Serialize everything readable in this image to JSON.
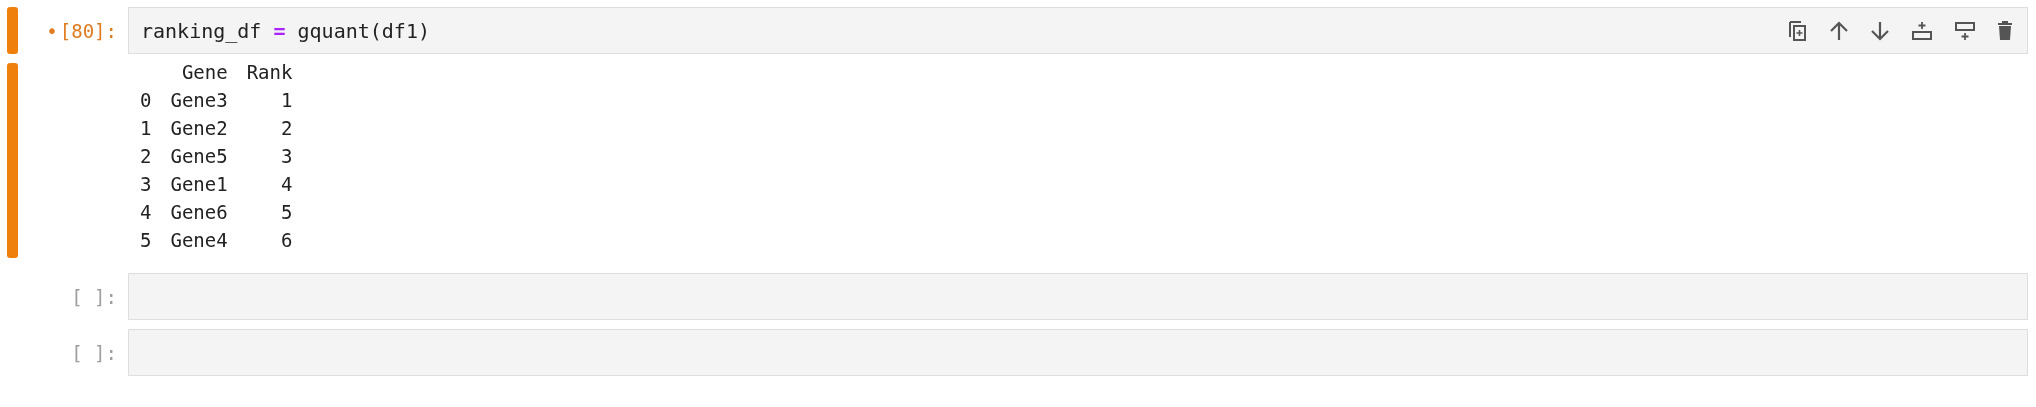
{
  "modified_mark": "•",
  "cells": [
    {
      "prompt": "[80]:",
      "selected": true,
      "modified": true,
      "code": [
        {
          "kind": "name",
          "text": "ranking_df "
        },
        {
          "kind": "operator",
          "text": "="
        },
        {
          "kind": "name",
          "text": " gquant(df1)"
        }
      ],
      "toolbar": [
        {
          "kind": "duplicate"
        },
        {
          "kind": "up"
        },
        {
          "kind": "down"
        },
        {
          "kind": "insert-above"
        },
        {
          "kind": "insert-below"
        },
        {
          "kind": "delete"
        }
      ],
      "output": {
        "columns": [
          "Gene",
          "Rank"
        ],
        "rows": [
          {
            "index": "0",
            "cells": [
              "Gene3",
              "1"
            ]
          },
          {
            "index": "1",
            "cells": [
              "Gene2",
              "2"
            ]
          },
          {
            "index": "2",
            "cells": [
              "Gene5",
              "3"
            ]
          },
          {
            "index": "3",
            "cells": [
              "Gene1",
              "4"
            ]
          },
          {
            "index": "4",
            "cells": [
              "Gene6",
              "5"
            ]
          },
          {
            "index": "5",
            "cells": [
              "Gene4",
              "6"
            ]
          }
        ]
      }
    },
    {
      "prompt": "[ ]:",
      "selected": false,
      "modified": false
    },
    {
      "prompt": "[ ]:",
      "selected": false,
      "modified": false
    }
  ]
}
